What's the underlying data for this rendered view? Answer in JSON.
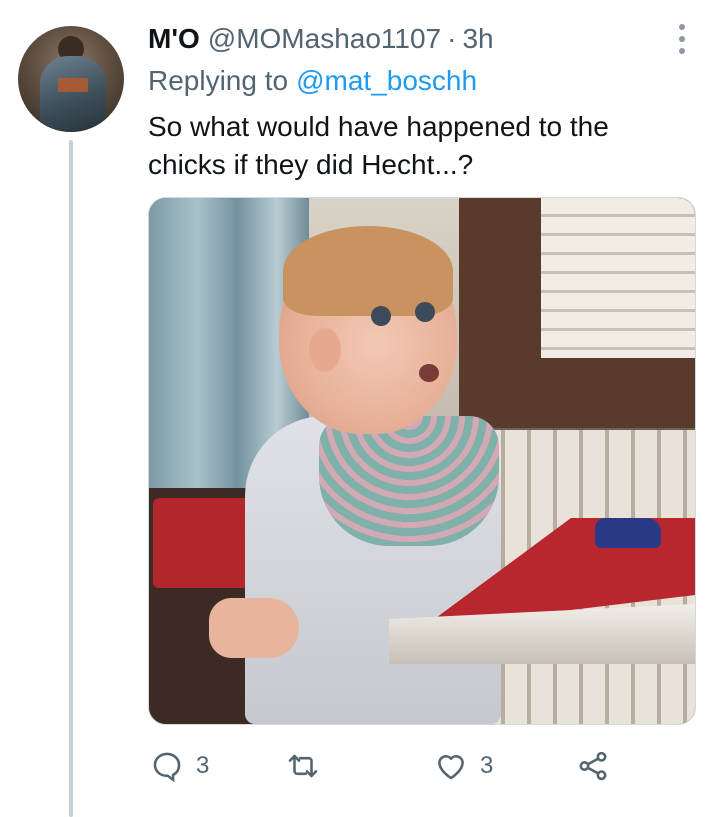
{
  "tweet": {
    "display_name": "M'O",
    "handle": "@MOMashao1107",
    "separator": "·",
    "time": "3h",
    "reply_prefix": "Replying to",
    "reply_to": "@mat_boschh",
    "text": "So what would have happened to the chicks if they did Hecht...?"
  },
  "actions": {
    "reply_count": "3",
    "retweet_count": "",
    "like_count": "3"
  },
  "icons": {
    "reply": "reply-icon",
    "retweet": "retweet-icon",
    "like": "heart-icon",
    "share": "share-icon",
    "more": "more-vertical-icon"
  },
  "colors": {
    "link": "#1d9bf0",
    "secondary_text": "#536471",
    "thread_line": "#c4cfd6"
  }
}
